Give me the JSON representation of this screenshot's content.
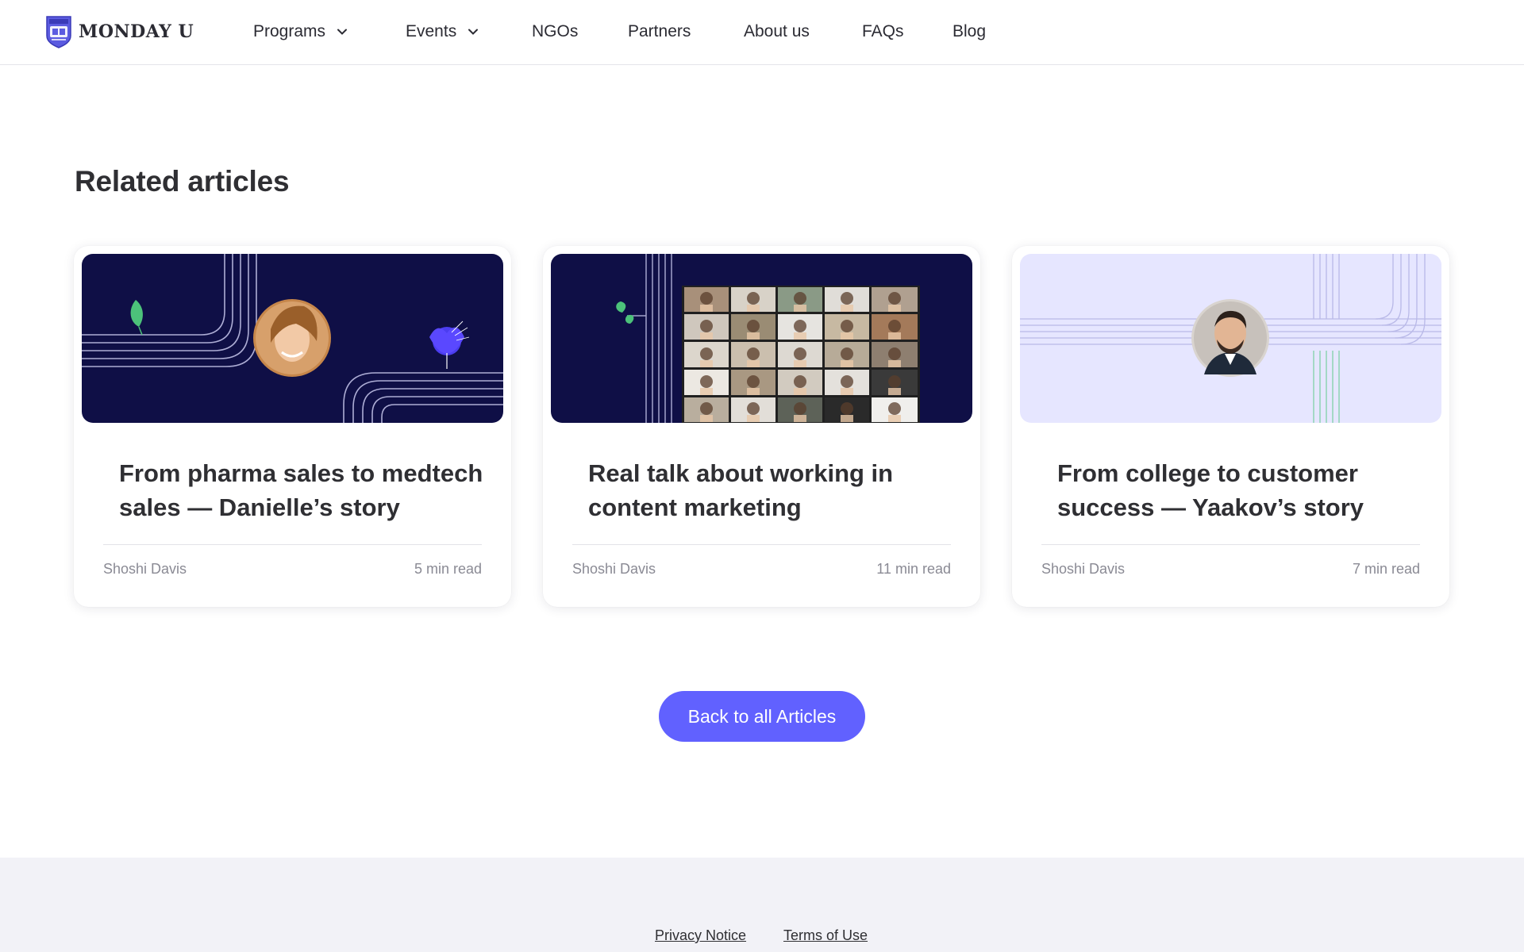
{
  "header": {
    "logo_text": "MONDAY U",
    "nav": [
      {
        "label": "Programs",
        "has_dropdown": true
      },
      {
        "label": "Events",
        "has_dropdown": true
      },
      {
        "label": "NGOs",
        "has_dropdown": false
      },
      {
        "label": "Partners",
        "has_dropdown": false
      },
      {
        "label": "About us",
        "has_dropdown": false
      },
      {
        "label": "FAQs",
        "has_dropdown": false
      },
      {
        "label": "Blog",
        "has_dropdown": false
      }
    ]
  },
  "related": {
    "title": "Related articles",
    "cards": [
      {
        "title": "From pharma sales to medtech sales — Danielle’s story",
        "author": "Shoshi Davis",
        "read_time": "5 min read",
        "image": "dark-navy-illustration-with-portrait"
      },
      {
        "title": "Real talk about working in content marketing",
        "author": "Shoshi Davis",
        "read_time": "11 min read",
        "image": "dark-navy-illustration-with-video-call-grid"
      },
      {
        "title": "From college to customer success — Yaakov’s story",
        "author": "Shoshi Davis",
        "read_time": "7 min read",
        "image": "lavender-illustration-with-portrait"
      }
    ]
  },
  "back_button": {
    "label": "Back to all Articles"
  },
  "footer": {
    "links": [
      {
        "label": "Privacy Notice"
      },
      {
        "label": "Terms of Use"
      }
    ]
  },
  "colors": {
    "brand_purple": "#6161ff",
    "navy": "#0f0f46",
    "lavender": "#e6e6ff",
    "footer_bg": "#f2f2f7"
  }
}
